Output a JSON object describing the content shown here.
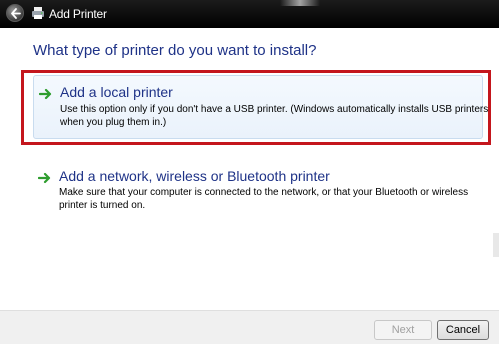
{
  "window": {
    "title": "Add Printer"
  },
  "page": {
    "heading": "What type of printer do you want to install?"
  },
  "options": [
    {
      "title": "Add a local printer",
      "description": "Use this option only if you don't have a USB printer. (Windows automatically installs USB printers when you plug them in.)",
      "highlighted": true
    },
    {
      "title": "Add a network, wireless or Bluetooth printer",
      "description": "Make sure that your computer is connected to the network, or that your Bluetooth or wireless printer is turned on.",
      "highlighted": false
    }
  ],
  "footer": {
    "next_label": "Next",
    "next_enabled": false,
    "cancel_label": "Cancel"
  },
  "icons": {
    "back": "back-arrow-icon",
    "title": "printer-icon",
    "option": "green-arrow-icon"
  },
  "colors": {
    "heading": "#1e3287",
    "highlight_frame": "#c4161d",
    "arrow": "#2e9d2e",
    "titlebar": "#000000"
  }
}
